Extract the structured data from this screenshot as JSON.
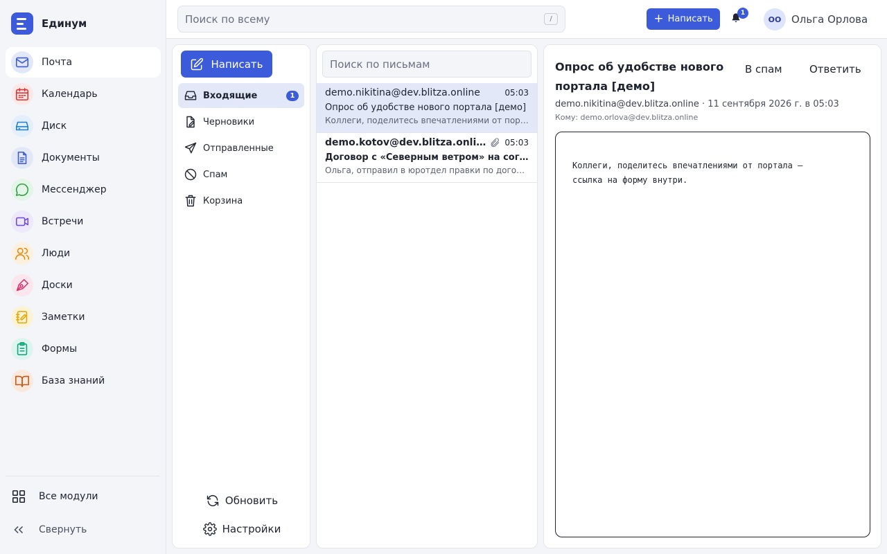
{
  "brand": {
    "name": "Единум"
  },
  "sidebar": {
    "items": [
      {
        "label": "Почта",
        "icon": "mail-icon",
        "color": "#3b5bdb",
        "bg": "#e3e8f9",
        "active": true
      },
      {
        "label": "Календарь",
        "icon": "calendar-icon",
        "color": "#e03131",
        "bg": "#fde8e8"
      },
      {
        "label": "Диск",
        "icon": "drive-icon",
        "color": "#1c7ed6",
        "bg": "#e3f0fb"
      },
      {
        "label": "Документы",
        "icon": "document-icon",
        "color": "#3b5bdb",
        "bg": "#e3e8f9"
      },
      {
        "label": "Мессенджер",
        "icon": "chat-icon",
        "color": "#2f9e44",
        "bg": "#e3f5e6"
      },
      {
        "label": "Встречи",
        "icon": "video-icon",
        "color": "#7048e8",
        "bg": "#ede8fc"
      },
      {
        "label": "Люди",
        "icon": "people-icon",
        "color": "#e8890c",
        "bg": "#fdf0df"
      },
      {
        "label": "Доски",
        "icon": "pen-icon",
        "color": "#d6336c",
        "bg": "#fbe6ee"
      },
      {
        "label": "Заметки",
        "icon": "notes-icon",
        "color": "#e6a700",
        "bg": "#fcf3d6"
      },
      {
        "label": "Формы",
        "icon": "clipboard-icon",
        "color": "#0ca678",
        "bg": "#ddf5ee"
      },
      {
        "label": "База знаний",
        "icon": "book-icon",
        "color": "#c2571a",
        "bg": "#f9e9dd"
      }
    ],
    "all_modules": "Все модули",
    "collapse": "Свернуть"
  },
  "topbar": {
    "search_placeholder": "Поиск по всему",
    "search_shortcut": "/",
    "compose_label": "Написать",
    "notifications_count": "1",
    "user_initials": "ОО",
    "user_name": "Ольга Орлова"
  },
  "folders": {
    "compose_label": "Написать",
    "items": [
      {
        "label": "Входящие",
        "icon": "inbox-icon",
        "count": "1",
        "active": true
      },
      {
        "label": "Черновики",
        "icon": "draft-icon"
      },
      {
        "label": "Отправленные",
        "icon": "send-icon"
      },
      {
        "label": "Спам",
        "icon": "spam-icon"
      },
      {
        "label": "Корзина",
        "icon": "trash-icon"
      }
    ],
    "refresh": "Обновить",
    "settings": "Настройки"
  },
  "messages": {
    "search_placeholder": "Поиск по письмам",
    "items": [
      {
        "sender": "demo.nikitina@dev.blitza.online",
        "time": "05:03",
        "subject": "Опрос об удобстве нового портала [демо]",
        "preview": "Коллеги, поделитесь впечатлениями от портала — ссылка на форму внутри.",
        "selected": true,
        "unread": false,
        "attachment": false
      },
      {
        "sender": "demo.kotov@dev.blitza.online",
        "time": "05:03",
        "subject": "Договор с «Северным ветром» на согласование",
        "preview": "Ольга, отправил в юротдел правки по договору",
        "selected": false,
        "unread": true,
        "attachment": true
      }
    ]
  },
  "reader": {
    "title": "Опрос об удобстве нового портала [демо]",
    "spam_button": "В спам",
    "reply_button": "Ответить",
    "from": "demo.nikitina@dev.blitza.online",
    "date": "· 11 сентября 2026 г. в 05:03",
    "to": "Кому: demo.orlova@dev.blitza.online",
    "body": "Коллеги, поделитесь впечатлениями от портала —\nссылка на форму внутри."
  }
}
